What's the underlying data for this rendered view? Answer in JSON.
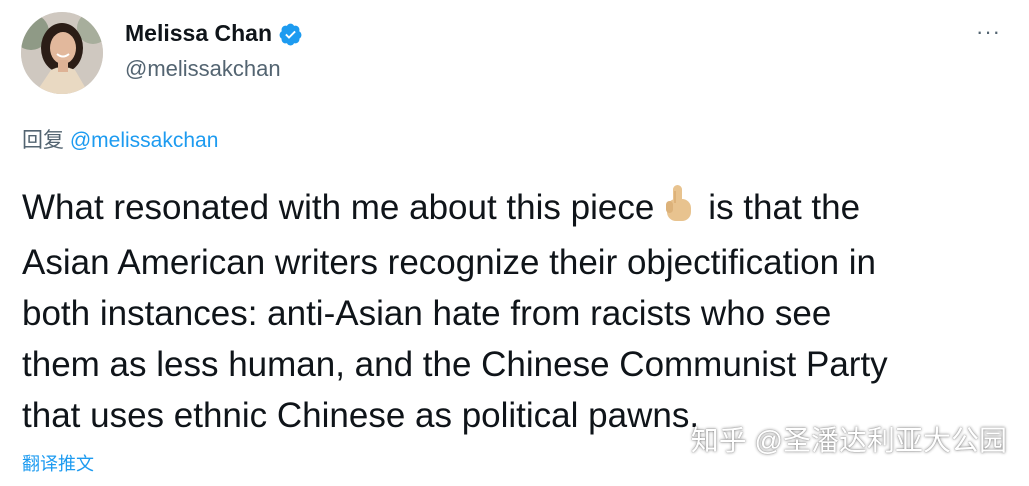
{
  "tweet": {
    "author": {
      "display_name": "Melissa Chan",
      "handle": "@melissakchan",
      "avatar_icon": "profile-photo",
      "verified_icon": "verified-badge-icon"
    },
    "more_label": "···",
    "reply": {
      "prefix": "回复",
      "mention": "@melissakchan"
    },
    "body_lines": [
      "What resonated with me about this piece",
      "is that the",
      "Asian American writers recognize their objectification in",
      "both instances: anti-Asian hate from racists who see",
      "them as less human, and the Chinese Communist Party",
      "that uses ethnic Chinese as political pawns."
    ],
    "emoji_icon": "pointing-up-hand-emoji",
    "translate_label": "翻译推文"
  },
  "watermark": "知乎 @圣潘达利亚大公园",
  "colors": {
    "text": "#0f1419",
    "secondary": "#536471",
    "accent": "#1d9bf0"
  }
}
